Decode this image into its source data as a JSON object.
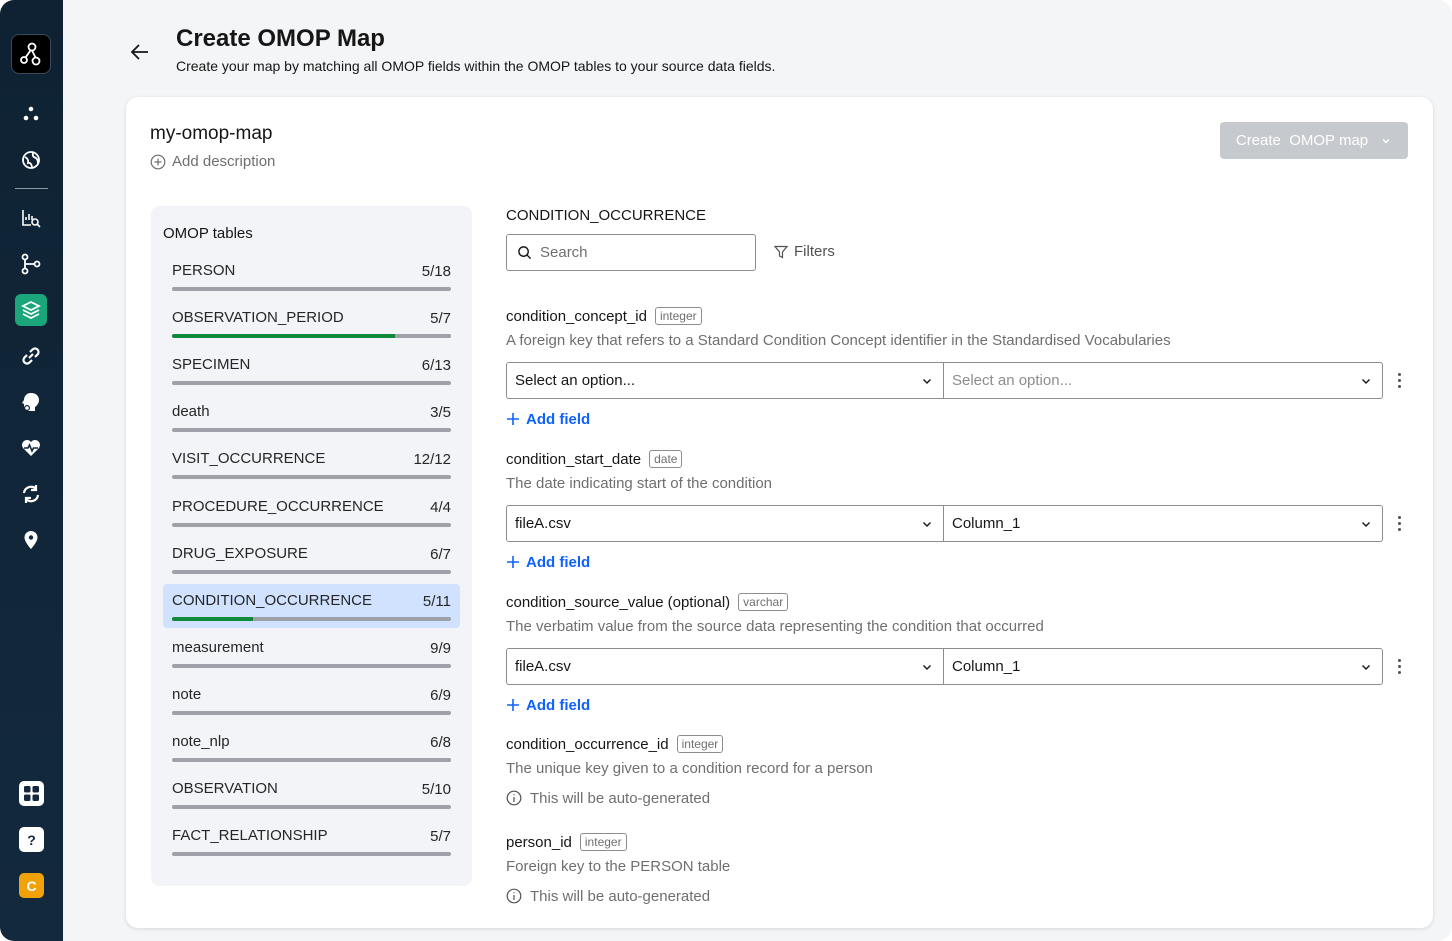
{
  "header": {
    "title": "Create OMOP Map",
    "subtitle": "Create your map by matching all OMOP fields within the OMOP tables to your source data fields."
  },
  "card": {
    "map_name": "my-omop-map",
    "add_description": "Add description",
    "create_button": "Create  OMOP map"
  },
  "tables_panel": {
    "title": "OMOP tables",
    "items": [
      {
        "name": "PERSON",
        "count": "5/18",
        "progress": 0
      },
      {
        "name": "OBSERVATION_PERIOD",
        "count": "5/7",
        "progress": 0.8
      },
      {
        "name": "SPECIMEN",
        "count": "6/13",
        "progress": 0
      },
      {
        "name": "death",
        "count": "3/5",
        "progress": 0
      },
      {
        "name": "VISIT_OCCURRENCE",
        "count": "12/12",
        "progress": 0
      },
      {
        "name": "PROCEDURE_OCCURRENCE",
        "count": "4/4",
        "progress": 0
      },
      {
        "name": "DRUG_EXPOSURE",
        "count": "6/7",
        "progress": 0
      },
      {
        "name": "CONDITION_OCCURRENCE",
        "count": "5/11",
        "progress": 0.29,
        "selected": true
      },
      {
        "name": "measurement",
        "count": "9/9",
        "progress": 0
      },
      {
        "name": "note",
        "count": "6/9",
        "progress": 0
      },
      {
        "name": "note_nlp",
        "count": "6/8",
        "progress": 0
      },
      {
        "name": "OBSERVATION",
        "count": "5/10",
        "progress": 0
      },
      {
        "name": "FACT_RELATIONSHIP",
        "count": "5/7",
        "progress": 0
      }
    ]
  },
  "content": {
    "section_title": "CONDITION_OCCURRENCE",
    "search_placeholder": "Search",
    "filters_label": "Filters",
    "add_field_label": "Add field",
    "auto_generated_label": "This will be auto-generated",
    "fields": [
      {
        "name": "condition_concept_id",
        "optional": "",
        "type": "integer",
        "description": "A foreign key that refers to a Standard Condition Concept identifier in the Standardised Vocabularies",
        "left_value": "Select an option...",
        "right_value": "Select an option..."
      },
      {
        "name": "condition_start_date",
        "optional": "",
        "type": "date",
        "description": "The date indicating start of the condition",
        "left_value": "fileA.csv",
        "right_value": "Column_1"
      },
      {
        "name": "condition_source_value",
        "optional": "(optional)",
        "type": "varchar",
        "description": "The verbatim value from the source data representing the condition that occurred",
        "left_value": "fileA.csv",
        "right_value": "Column_1"
      },
      {
        "name": "condition_occurrence_id",
        "optional": "",
        "type": "integer",
        "description": "The unique key given to a condition record for a person"
      },
      {
        "name": "person_id",
        "optional": "",
        "type": "integer",
        "description": "Foreign key to the PERSON table"
      }
    ]
  },
  "sidebar": {
    "items": [
      {
        "icon": "cluster-icon"
      },
      {
        "icon": "globe-icon"
      },
      {
        "icon": "data-explore-icon"
      },
      {
        "icon": "pipeline-icon"
      },
      {
        "icon": "layers-icon",
        "active": true
      },
      {
        "icon": "link-icon"
      },
      {
        "icon": "ai-head-icon"
      },
      {
        "icon": "health-icon"
      },
      {
        "icon": "sync-icon"
      },
      {
        "icon": "location-pin-icon"
      }
    ],
    "bottom": {
      "help_glyph": "?",
      "avatar_letter": "C"
    }
  },
  "colors": {
    "sidebar": "#13293d",
    "active_nav": "#1aa57a",
    "progress_green": "#0e8a3a",
    "selected_row": "#d0e2ff",
    "link_blue": "#0f62fe",
    "avatar": "#f1a208"
  }
}
